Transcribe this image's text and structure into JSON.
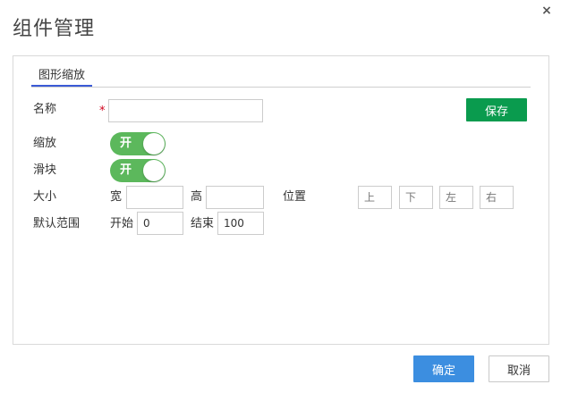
{
  "dialog": {
    "title": "组件管理",
    "close_symbol": "×"
  },
  "tabs": [
    {
      "label": "图形缩放",
      "active": true
    }
  ],
  "form": {
    "name_label": "名称",
    "required_mark": "*",
    "name_value": "",
    "save_label": "保存",
    "zoom_label": "缩放",
    "zoom_toggle": "开",
    "slider_label": "滑块",
    "slider_toggle": "开",
    "size_label": "大小",
    "width_label": "宽",
    "width_value": "",
    "height_label": "高",
    "height_value": "",
    "position_label": "位置",
    "top_placeholder": "上",
    "bottom_placeholder": "下",
    "left_placeholder": "左",
    "right_placeholder": "右",
    "range_label": "默认范围",
    "start_label": "开始",
    "start_value": "0",
    "end_label": "结束",
    "end_value": "100"
  },
  "footer": {
    "ok_label": "确定",
    "cancel_label": "取消"
  },
  "colors": {
    "save_button": "#0a9b4e",
    "toggle_on": "#5cb85c",
    "ok_button": "#3c8ee0",
    "tab_underline": "#3b5bd6",
    "required": "#d0021b"
  }
}
